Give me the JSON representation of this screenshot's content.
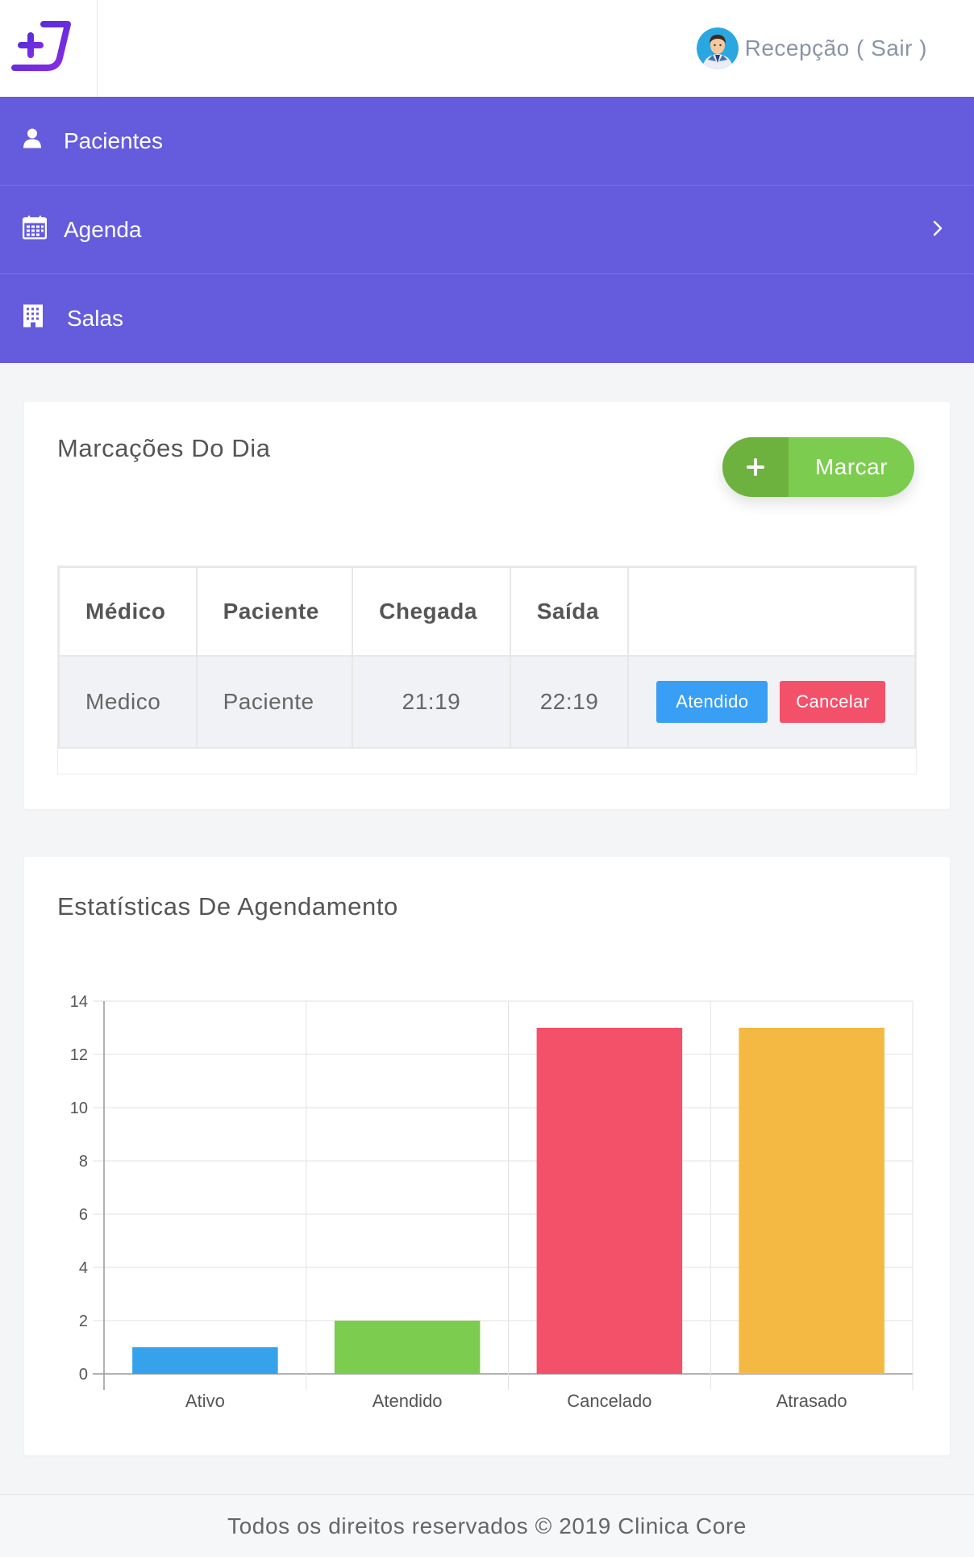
{
  "header": {
    "user_label": "Recepção ( Sair )"
  },
  "nav": {
    "items": [
      {
        "label": "Pacientes",
        "icon": "user-icon"
      },
      {
        "label": "Agenda",
        "icon": "calendar-icon"
      },
      {
        "label": "Salas",
        "icon": "building-icon"
      }
    ]
  },
  "appointments": {
    "title": "Marcações Do Dia",
    "add_button": "Marcar",
    "columns": [
      "Médico",
      "Paciente",
      "Chegada",
      "Saída",
      ""
    ],
    "rows": [
      {
        "medico": "Medico",
        "paciente": "Paciente",
        "chegada": "21:19",
        "saida": "22:19",
        "attended_label": "Atendido",
        "cancel_label": "Cancelar"
      }
    ]
  },
  "stats": {
    "title": "Estatísticas De Agendamento"
  },
  "chart_data": {
    "type": "bar",
    "categories": [
      "Ativo",
      "Atendido",
      "Cancelado",
      "Atrasado"
    ],
    "values": [
      1,
      2,
      13,
      13
    ],
    "colors": [
      "#36a2eb",
      "#7ccc4f",
      "#f35069",
      "#f4b942"
    ],
    "ylim": [
      0,
      14
    ],
    "yticks": [
      "0",
      "2",
      "4",
      "6",
      "8",
      "10",
      "12",
      "14"
    ],
    "grid": true,
    "title": "",
    "xlabel": "",
    "ylabel": ""
  },
  "footer": {
    "text": "Todos os direitos reservados © 2019 Clinica Core"
  },
  "colors": {
    "primary": "#645cdc",
    "success": "#7ccc4f",
    "info": "#389ff4",
    "danger": "#f35069"
  }
}
